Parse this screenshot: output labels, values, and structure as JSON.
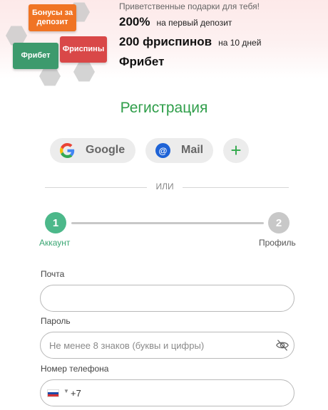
{
  "promo": {
    "badges": {
      "bonus": "Бонусы за депозит",
      "freebet": "Фрибет",
      "spins": "Фриспины"
    },
    "greeting": "Приветственные подарки для тебя!",
    "line1_big": "200%",
    "line1_small": "на первый депозит",
    "line2_big": "200 фриспинов",
    "line2_small": "на 10 дней",
    "line3_big": "Фрибет"
  },
  "registration": {
    "title": "Регистрация"
  },
  "social": {
    "google_label": "Google",
    "mail_label": "Mail",
    "mail_icon_glyph": "@",
    "plus_glyph": "+"
  },
  "divider": {
    "label": "ИЛИ"
  },
  "steps": [
    {
      "number": "1",
      "label": "Аккаунт",
      "active": true
    },
    {
      "number": "2",
      "label": "Профиль",
      "active": false
    }
  ],
  "form": {
    "email_label": "Почта",
    "email_value": "",
    "password_label": "Пароль",
    "password_placeholder": "Не менее 8 знаков (буквы и цифры)",
    "phone_label": "Номер телефона",
    "phone_value": "+7",
    "country_caret": "▼"
  },
  "colors": {
    "accent_green": "#2f9e4a",
    "step_active": "#4cb88a",
    "step_inactive": "#c8c8c8",
    "badge_orange": "#f07424",
    "badge_green": "#3d9a6d",
    "badge_red": "#d94848"
  },
  "icons": {
    "google": "google-icon",
    "mail": "mail-icon",
    "plus": "plus-icon",
    "eye": "eye-off-icon",
    "flag": "russia-flag-icon"
  }
}
